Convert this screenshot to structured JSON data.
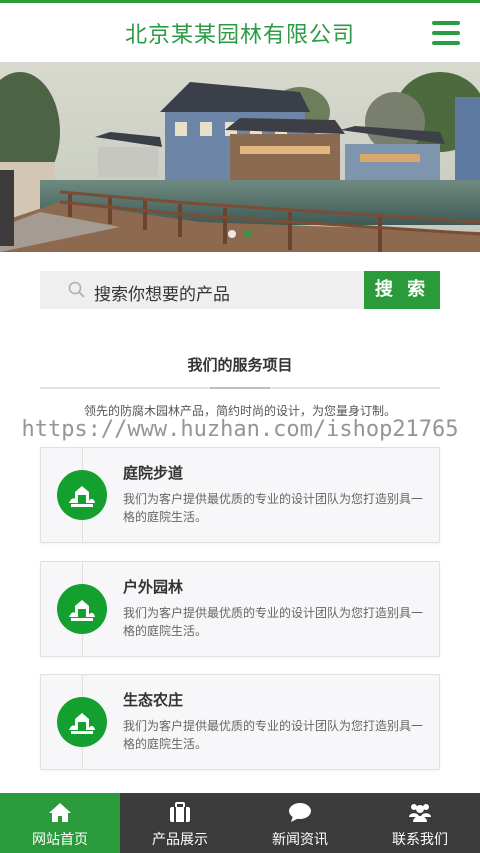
{
  "header": {
    "brand": "北京某某园林有限公司",
    "menu_icon": "hamburger-menu-icon",
    "accent": "#2c9b45"
  },
  "banner": {
    "slides": 2,
    "active_slide": 2
  },
  "search": {
    "placeholder": "搜索你想要的产品",
    "button": "搜 索"
  },
  "services": {
    "title": "我们的服务项目",
    "subtitle": "领先的防腐木园林产品，简约时尚的设计，为您量身订制。",
    "watermark": "https://www.huzhan.com/ishop21765",
    "items": [
      {
        "name": "庭院步道",
        "desc": "我们为客户提供最优质的专业的设计团队为您打造别具一格的庭院生活。"
      },
      {
        "name": "户外园林",
        "desc": "我们为客户提供最优质的专业的设计团队为您打造别具一格的庭院生活。"
      },
      {
        "name": "生态农庄",
        "desc": "我们为客户提供最优质的专业的设计团队为您打造别具一格的庭院生活。"
      }
    ]
  },
  "bottom_nav": [
    {
      "label": "网站首页",
      "icon": "home-icon",
      "active": true
    },
    {
      "label": "产品展示",
      "icon": "briefcase-icon",
      "active": false
    },
    {
      "label": "新闻资讯",
      "icon": "chat-bubble-icon",
      "active": false
    },
    {
      "label": "联系我们",
      "icon": "users-icon",
      "active": false
    }
  ]
}
